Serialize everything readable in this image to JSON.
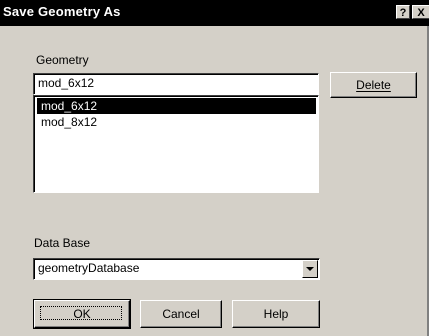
{
  "window": {
    "title": "Save Geometry As",
    "help_glyph": "?",
    "close_glyph": "X"
  },
  "geometry": {
    "label": "Geometry",
    "input_value": "mod_6x12",
    "items": [
      {
        "label": "mod_6x12",
        "selected": true
      },
      {
        "label": "mod_8x12",
        "selected": false
      }
    ],
    "delete_label": "Delete"
  },
  "database": {
    "label": "Data Base",
    "selected_value": "geometryDatabase"
  },
  "buttons": {
    "ok_label": "OK",
    "cancel_label": "Cancel",
    "help_label": "Help"
  }
}
